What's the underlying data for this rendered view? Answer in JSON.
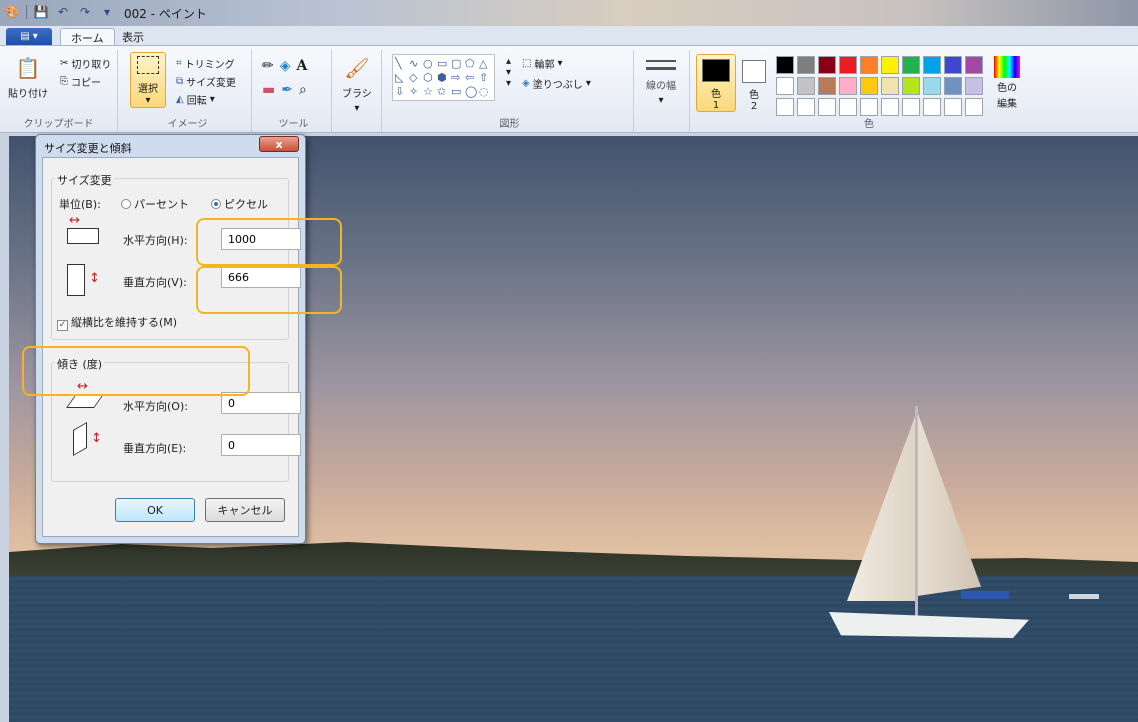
{
  "titlebar": {
    "title": "002 - ペイント"
  },
  "tabs": {
    "file": "",
    "home": "ホーム",
    "view": "表示"
  },
  "ribbon": {
    "clipboard": {
      "paste": "貼り付け",
      "cut": "切り取り",
      "copy": "コピー",
      "label": "クリップボード"
    },
    "image": {
      "select": "選択",
      "crop": "トリミング",
      "resize": "サイズ変更",
      "rotate": "回転",
      "label": "イメージ"
    },
    "tools": {
      "label": "ツール"
    },
    "brush": {
      "label": "ブラシ"
    },
    "shapes": {
      "outline": "輪郭",
      "fill": "塗りつぶし",
      "label": "図形"
    },
    "size": {
      "label": "線の幅"
    },
    "colors": {
      "color1": "色",
      "color1_num": "1",
      "color2": "色",
      "color2_num": "2",
      "edit": "色の",
      "edit2": "編集",
      "label": "色"
    }
  },
  "palette": [
    "#000000",
    "#7f7f7f",
    "#880015",
    "#ed1c24",
    "#ff7f27",
    "#fff200",
    "#22b14c",
    "#00a2e8",
    "#3f48cc",
    "#a349a4",
    "#ffffff",
    "#c3c3c3",
    "#b97a57",
    "#ffaec9",
    "#ffc90e",
    "#efe4b0",
    "#b5e61d",
    "#99d9ea",
    "#7092be",
    "#c8bfe7",
    "#ffffff",
    "#ffffff",
    "#ffffff",
    "#ffffff",
    "#ffffff",
    "#ffffff",
    "#ffffff",
    "#ffffff",
    "#ffffff",
    "#ffffff"
  ],
  "dialog": {
    "title": "サイズ変更と傾斜",
    "close": "x",
    "resize_legend": "サイズ変更",
    "unit_label": "単位(B):",
    "percent": "パーセント",
    "pixel": "ピクセル",
    "horizontal_label": "水平方向(H):",
    "horizontal_value": "1000",
    "vertical_label": "垂直方向(V):",
    "vertical_value": "666",
    "keep_aspect": "縦横比を維持する(M)",
    "skew_legend": "傾き (度)",
    "skew_h_label": "水平方向(O):",
    "skew_h_value": "0",
    "skew_v_label": "垂直方向(E):",
    "skew_v_value": "0",
    "ok": "OK",
    "cancel": "キャンセル"
  },
  "accent": {
    "highlight": "#f5b520"
  }
}
